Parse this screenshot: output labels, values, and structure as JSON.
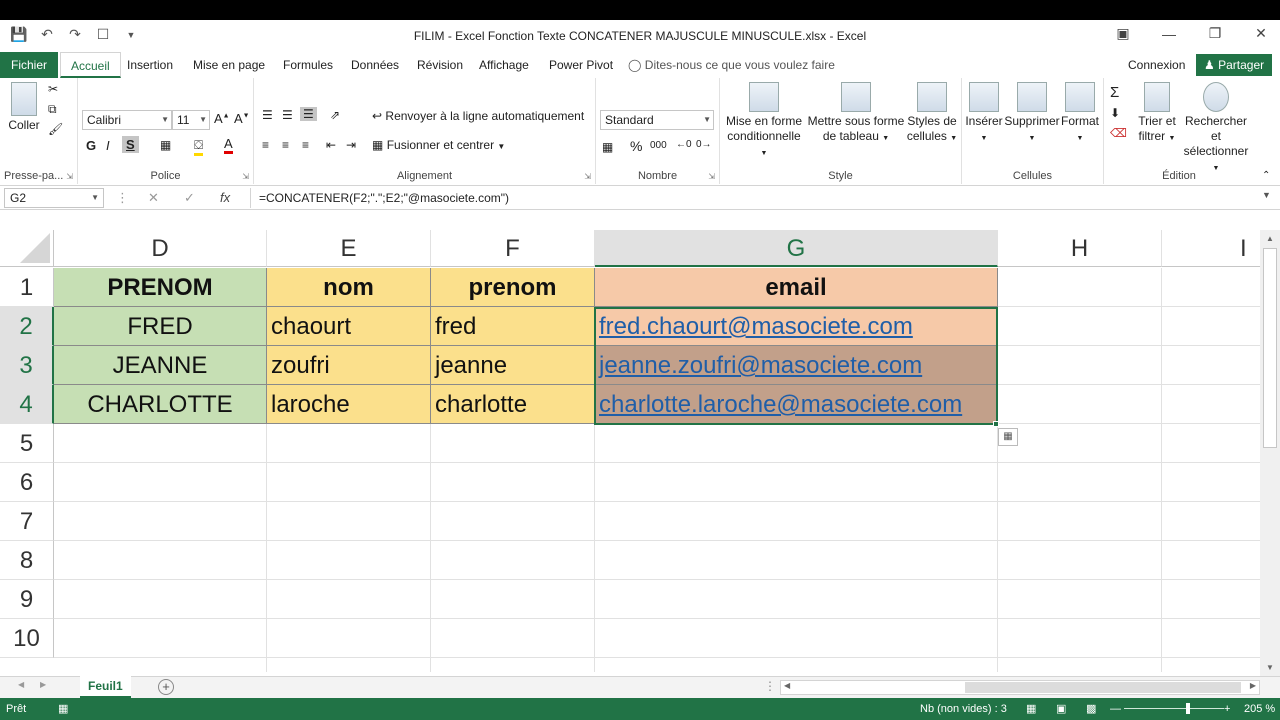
{
  "window": {
    "title": "FILIM - Excel Fonction Texte CONCATENER MAJUSCULE MINUSCULE.xlsx - Excel"
  },
  "ribbon_tabs": {
    "file": "Fichier",
    "home": "Accueil",
    "insert": "Insertion",
    "layout": "Mise en page",
    "formulas": "Formules",
    "data": "Données",
    "review": "Révision",
    "view": "Affichage",
    "powerpivot": "Power Pivot",
    "tellme": "Dites-nous ce que vous voulez faire",
    "signin": "Connexion",
    "share": "Partager"
  },
  "ribbon": {
    "clipboard": {
      "paste": "Coller",
      "label": "Presse-pa..."
    },
    "font": {
      "name": "Calibri",
      "size": "11",
      "bold": "G",
      "italic": "I",
      "underline": "S",
      "label": "Police"
    },
    "alignment": {
      "wrap": "Renvoyer à la ligne automatiquement",
      "merge": "Fusionner et centrer",
      "label": "Alignement"
    },
    "number": {
      "format": "Standard",
      "percent": "%",
      "thousands": "000",
      "label": "Nombre"
    },
    "styles": {
      "conditional_1": "Mise en forme",
      "conditional_2": "conditionnelle",
      "table_1": "Mettre sous forme",
      "table_2": "de tableau",
      "cell_1": "Styles de",
      "cell_2": "cellules",
      "label": "Style"
    },
    "cells": {
      "insert": "Insérer",
      "delete": "Supprimer",
      "format": "Format",
      "label": "Cellules"
    },
    "editing": {
      "sort_1": "Trier et",
      "sort_2": "filtrer",
      "find_1": "Rechercher et",
      "find_2": "sélectionner",
      "label": "Édition"
    }
  },
  "formula_bar": {
    "name_box": "G2",
    "formula": "=CONCATENER(F2;\".\";E2;\"@masociete.com\")"
  },
  "columns": [
    "D",
    "E",
    "F",
    "G",
    "H",
    "I"
  ],
  "rows": [
    "1",
    "2",
    "3",
    "4",
    "5",
    "6",
    "7",
    "8",
    "9",
    "10"
  ],
  "table": {
    "headers": [
      "PRENOM",
      "nom",
      "prenom",
      "email"
    ],
    "data": [
      [
        "FRED",
        "chaourt",
        "fred",
        "fred.chaourt@masociete.com"
      ],
      [
        "JEANNE",
        "zoufri",
        "jeanne",
        "jeanne.zoufri@masociete.com"
      ],
      [
        "CHARLOTTE",
        "laroche",
        "charlotte",
        "charlotte.laroche@masociete.com"
      ]
    ]
  },
  "sheets": {
    "active": "Feuil1"
  },
  "status": {
    "ready": "Prêt",
    "count": "Nb (non vides) : 3",
    "zoom": "205 %"
  },
  "colors": {
    "accent": "#217346",
    "col_d": "#c6dfb4",
    "col_ef": "#fbe08c",
    "col_g": "#f6c9a8",
    "link": "#1f5ea8"
  }
}
